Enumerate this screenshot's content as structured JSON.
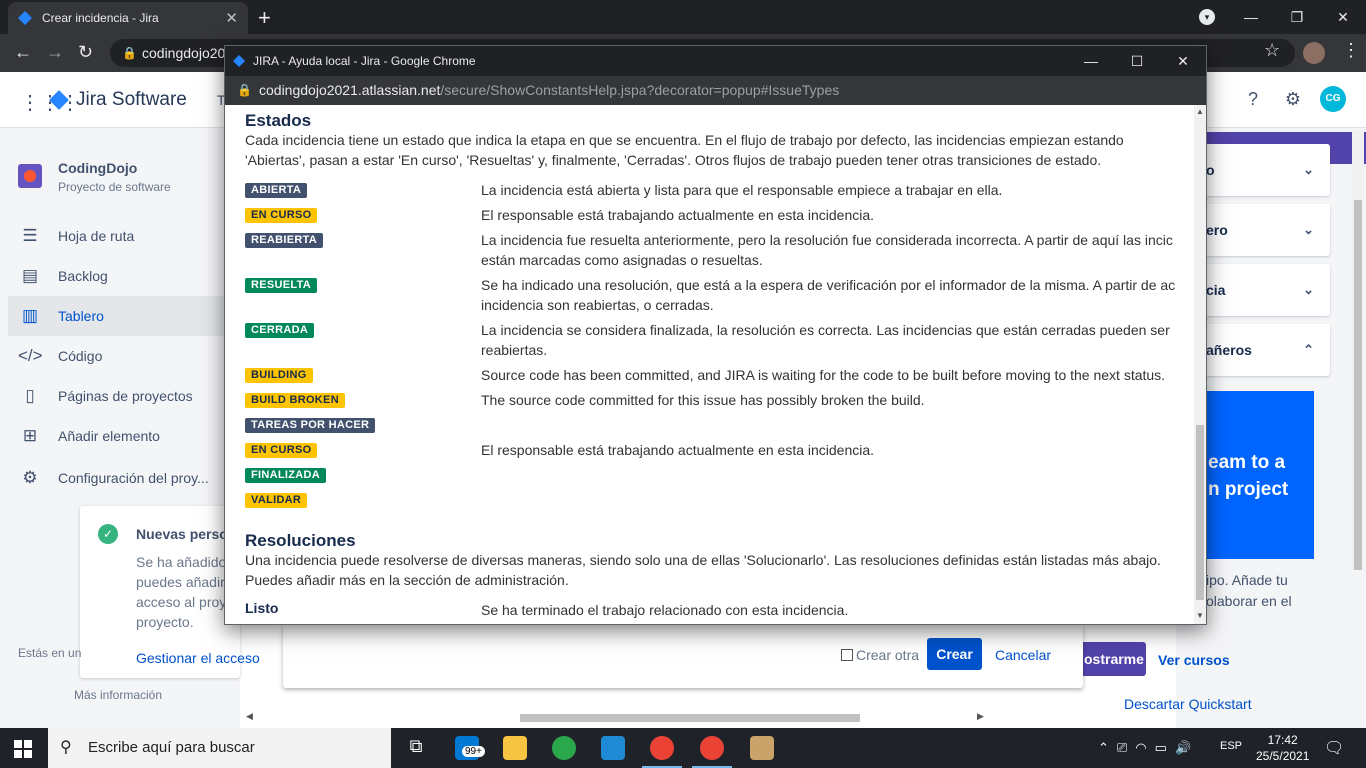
{
  "browser": {
    "tab_title": "Crear incidencia - Jira",
    "address_text": "codingdojo20",
    "new_tab_symbol": "+",
    "tab_close_symbol": "✕"
  },
  "jira": {
    "product": "Jira Software",
    "header_stub": "T",
    "avatar_initials": "CG",
    "project": {
      "name": "CodingDojo",
      "type": "Proyecto de software"
    },
    "nav": [
      {
        "label": "Hoja de ruta",
        "icon": "roadmap-icon"
      },
      {
        "label": "Backlog",
        "icon": "backlog-icon"
      },
      {
        "label": "Tablero",
        "icon": "board-icon"
      },
      {
        "label": "Código",
        "icon": "code-icon"
      },
      {
        "label": "Páginas de proyectos",
        "icon": "pages-icon"
      },
      {
        "label": "Añadir elemento",
        "icon": "add-item-icon"
      },
      {
        "label": "Configuración del proy...",
        "icon": "settings-icon"
      }
    ],
    "access_card": {
      "title": "Nuevas person",
      "body": "Se ha añadido puedes añadir acceso al proy proyecto.",
      "link": "Gestionar el acceso"
    },
    "footer_note": "Estás en un",
    "more_info": "Más información",
    "right_panel": {
      "cards": [
        "o",
        "ero",
        "cia",
        "añeros"
      ],
      "promo_line1": "eam to a",
      "promo_line2": "n project",
      "text": "ipo. Añade tu olaborar en el"
    },
    "quickstart": {
      "show_me": "ostrarme",
      "view_courses": "Ver cursos",
      "dismiss": "Descartar Quickstart"
    },
    "dialog": {
      "create_another": "Crear otra",
      "create": "Crear",
      "cancel": "Cancelar"
    }
  },
  "popup": {
    "title": "JIRA - Ayuda local - Jira - Google Chrome",
    "url_host": "codingdojo2021.atlassian.net",
    "url_path": "/secure/ShowConstantsHelp.jspa?decorator=popup#IssueTypes",
    "estados_heading": "Estados",
    "estados_intro": "Cada incidencia tiene un estado que indica la etapa en que se encuentra. En el flujo de trabajo por defecto, las incidencias empiezan estando 'Abiertas', pasan a estar 'En curso', 'Resueltas' y, finalmente, 'Cerradas'. Otros flujos de trabajo pueden tener otras transiciones de estado.",
    "statuses": [
      {
        "label": "ABIERTA",
        "color": "gray",
        "desc": "La incidencia está abierta y lista para que el responsable empiece a trabajar en ella."
      },
      {
        "label": "EN CURSO",
        "color": "yellow",
        "desc": "El responsable está trabajando actualmente en esta incidencia."
      },
      {
        "label": "REABIERTA",
        "color": "gray",
        "desc": "La incidencia fue resuelta anteriormente, pero la resolución fue considerada incorrecta. A partir de aquí las incic están marcadas como asignadas o resueltas."
      },
      {
        "label": "RESUELTA",
        "color": "green",
        "desc": "Se ha indicado una resolución, que está a la espera de verificación por el informador de la misma. A partir de ac incidencia son reabiertas, o cerradas."
      },
      {
        "label": "CERRADA",
        "color": "green",
        "desc": "La incidencia se considera finalizada, la resolución es correcta. Las incidencias que están cerradas pueden ser reabiertas."
      },
      {
        "label": "BUILDING",
        "color": "yellow",
        "desc": "Source code has been committed, and JIRA is waiting for the code to be built before moving to the next status."
      },
      {
        "label": "BUILD BROKEN",
        "color": "yellow",
        "desc": "The source code committed for this issue has possibly broken the build."
      },
      {
        "label": "TAREAS POR HACER",
        "color": "gray",
        "desc": ""
      },
      {
        "label": "EN CURSO",
        "color": "yellow",
        "desc": "El responsable está trabajando actualmente en esta incidencia."
      },
      {
        "label": "FINALIZADA",
        "color": "green",
        "desc": ""
      },
      {
        "label": "VALIDAR",
        "color": "yellow",
        "desc": ""
      }
    ],
    "resoluciones_heading": "Resoluciones",
    "resoluciones_intro": "Una incidencia puede resolverse de diversas maneras, siendo solo una de ellas 'Solucionarlo'. Las resoluciones definidas están listadas más abajo. Puedes añadir más en la sección de administración.",
    "resolutions": [
      {
        "label": "Listo",
        "desc": "Se ha terminado el trabajo relacionado con esta incidencia."
      }
    ]
  },
  "taskbar": {
    "search_placeholder": "Escribe aquí para buscar",
    "mail_badge": "99+",
    "language": "ESP",
    "time": "17:42",
    "date": "25/5/2021"
  },
  "colors": {
    "lozenge_gray": "#42526e",
    "lozenge_yellow": "#ffc400",
    "lozenge_green": "#00875a",
    "jira_blue": "#0052cc"
  }
}
